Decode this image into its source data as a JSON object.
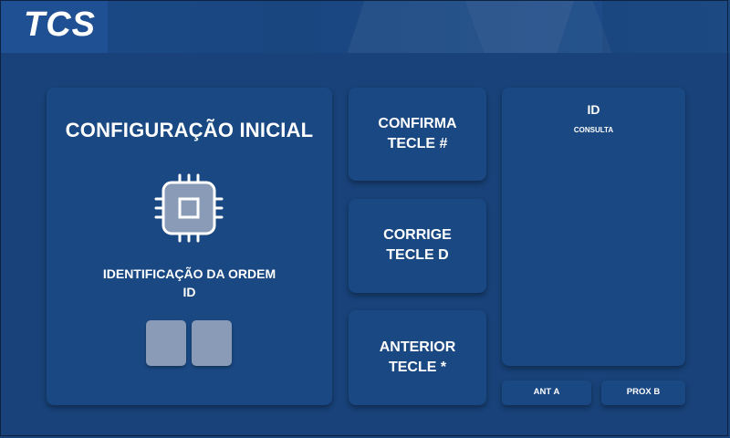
{
  "header": {
    "logo_text": "TCS"
  },
  "main": {
    "title": "CONFIGURAÇÃO INICIAL",
    "icon": "cpu-chip-icon",
    "id_label_line1": "IDENTIFICAÇÃO DA ORDEM",
    "id_label_line2": "ID",
    "digit_values": [
      "",
      ""
    ]
  },
  "actions": {
    "confirm_line1": "CONFIRMA",
    "confirm_line2": "TECLE #",
    "correct_line1": "CORRIGE",
    "correct_line2": "TECLE D",
    "previous_line1": "ANTERIOR",
    "previous_line2": "TECLE *"
  },
  "panel": {
    "title": "ID",
    "subtitle": "CONSULTA",
    "prev_label": "ANT A",
    "next_label": "PROX B"
  },
  "colors": {
    "background": "#184279",
    "card": "#1a4883",
    "digit_box": "#8a9bb7",
    "text": "#ffffff"
  }
}
